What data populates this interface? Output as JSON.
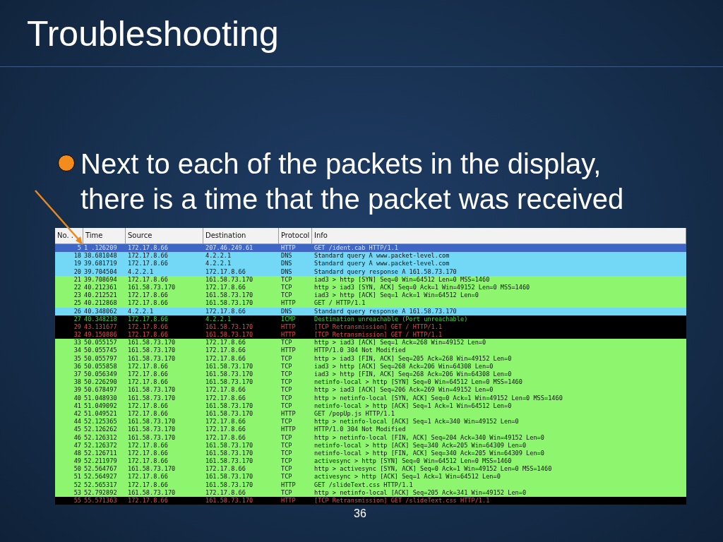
{
  "slide": {
    "title": "Troubleshooting",
    "bullet": "Next to each of the packets in the display, there is a time that the packet was received",
    "page_number": "36"
  },
  "table": {
    "columns": [
      "No. .",
      "Time",
      "Source",
      "Destination",
      "Protocol",
      "Info"
    ],
    "rows": [
      {
        "kind": "normal",
        "selected": true,
        "cells": [
          "5",
          "1 .126209",
          "172.17.8.66",
          "207.46.249.61",
          "HTTP",
          "GET /ident.cab HTTP/1.1"
        ]
      },
      {
        "kind": "dns",
        "selected": false,
        "cells": [
          "18",
          "38.681048",
          "172.17.8.66",
          "4.2.2.1",
          "DNS",
          "Standard query A www.packet-level.com"
        ]
      },
      {
        "kind": "dns",
        "selected": false,
        "cells": [
          "19",
          "39.681719",
          "172.17.8.66",
          "4.2.2.1",
          "DNS",
          "Standard query A www.packet-level.com"
        ]
      },
      {
        "kind": "dns",
        "selected": false,
        "cells": [
          "20",
          "39.704504",
          "4.2.2.1",
          "172.17.8.66",
          "DNS",
          "Standard query response A 161.58.73.170"
        ]
      },
      {
        "kind": "tcp",
        "selected": false,
        "cells": [
          "21",
          "39.708694",
          "172.17.8.66",
          "161.58.73.170",
          "TCP",
          "iad3 > http [SYN] Seq=0 Win=64512 Len=0 MSS=1460"
        ]
      },
      {
        "kind": "tcp",
        "selected": false,
        "cells": [
          "22",
          "40.212361",
          "161.58.73.170",
          "172.17.8.66",
          "TCP",
          "http > iad3 [SYN, ACK] Seq=0 Ack=1 Win=49152 Len=0 MSS=1460"
        ]
      },
      {
        "kind": "tcp",
        "selected": false,
        "cells": [
          "23",
          "40.212521",
          "172.17.8.66",
          "161.58.73.170",
          "TCP",
          "iad3 > http [ACK] Seq=1 Ack=1 Win=64512 Len=0"
        ]
      },
      {
        "kind": "tcp",
        "selected": false,
        "cells": [
          "25",
          "40.212868",
          "172.17.8.66",
          "161.58.73.170",
          "HTTP",
          "GET / HTTP/1.1"
        ]
      },
      {
        "kind": "dns",
        "selected": false,
        "cells": [
          "26",
          "40.348062",
          "4.2.2.1",
          "172.17.8.66",
          "DNS",
          "Standard query response A 161.58.73.170"
        ]
      },
      {
        "kind": "icmp",
        "selected": false,
        "cells": [
          "27",
          "40.348218",
          "172.17.8.66",
          "4.2.2.1",
          "ICMP",
          "Destination unreachable (Port unreachable)"
        ]
      },
      {
        "kind": "retrans",
        "selected": false,
        "cells": [
          "29",
          "43.131677",
          "172.17.8.66",
          "161.58.73.170",
          "HTTP",
          "[TCP Retransmission] GET / HTTP/1.1"
        ]
      },
      {
        "kind": "retrans",
        "selected": false,
        "cells": [
          "32",
          "49.150886",
          "172.17.8.66",
          "161.58.73.170",
          "HTTP",
          "[TCP Retransmission] GET / HTTP/1.1"
        ]
      },
      {
        "kind": "tcp",
        "selected": false,
        "cells": [
          "33",
          "50.055157",
          "161.58.73.170",
          "172.17.8.66",
          "TCP",
          "http > iad3 [ACK] Seq=1 Ack=268 Win=49152 Len=0"
        ]
      },
      {
        "kind": "tcp",
        "selected": false,
        "cells": [
          "34",
          "50.055745",
          "161.58.73.170",
          "172.17.8.66",
          "HTTP",
          "HTTP/1.0 304 Not Modified"
        ]
      },
      {
        "kind": "tcp",
        "selected": false,
        "cells": [
          "35",
          "50.055797",
          "161.58.73.170",
          "172.17.8.66",
          "TCP",
          "http > iad3 [FIN, ACK] Seq=205 Ack=268 Win=49152 Len=0"
        ]
      },
      {
        "kind": "tcp",
        "selected": false,
        "cells": [
          "36",
          "50.055858",
          "172.17.8.66",
          "161.58.73.170",
          "TCP",
          "iad3 > http [ACK] Seq=268 Ack=206 Win=64308 Len=0"
        ]
      },
      {
        "kind": "tcp",
        "selected": false,
        "cells": [
          "37",
          "50.056349",
          "172.17.8.66",
          "161.58.73.170",
          "TCP",
          "iad3 > http [FIN, ACK] Seq=268 Ack=206 Win=64308 Len=0"
        ]
      },
      {
        "kind": "tcp",
        "selected": false,
        "cells": [
          "38",
          "50.226290",
          "172.17.8.66",
          "161.58.73.170",
          "TCP",
          "netinfo-local > http [SYN] Seq=0 Win=64512 Len=0 MSS=1460"
        ]
      },
      {
        "kind": "tcp",
        "selected": false,
        "cells": [
          "39",
          "50.678497",
          "161.58.73.170",
          "172.17.8.66",
          "TCP",
          "http > iad3 [ACK] Seq=206 Ack=269 Win=49152 Len=0"
        ]
      },
      {
        "kind": "tcp",
        "selected": false,
        "cells": [
          "40",
          "51.048930",
          "161.58.73.170",
          "172.17.8.66",
          "TCP",
          "http > netinfo-local [SYN, ACK] Seq=0 Ack=1 Win=49152 Len=0 MSS=1460"
        ]
      },
      {
        "kind": "tcp",
        "selected": false,
        "cells": [
          "41",
          "51.049092",
          "172.17.8.66",
          "161.58.73.170",
          "TCP",
          "netinfo-local > http [ACK] Seq=1 Ack=1 Win=64512 Len=0"
        ]
      },
      {
        "kind": "tcp",
        "selected": false,
        "cells": [
          "42",
          "51.049521",
          "172.17.8.66",
          "161.58.73.170",
          "HTTP",
          "GET /popUp.js HTTP/1.1"
        ]
      },
      {
        "kind": "tcp",
        "selected": false,
        "cells": [
          "44",
          "52.125365",
          "161.58.73.170",
          "172.17.8.66",
          "TCP",
          "http > netinfo-local [ACK] Seq=1 Ack=340 Win=49152 Len=0"
        ]
      },
      {
        "kind": "tcp",
        "selected": false,
        "cells": [
          "45",
          "52.126262",
          "161.58.73.170",
          "172.17.8.66",
          "HTTP",
          "HTTP/1.0 304 Not Modified"
        ]
      },
      {
        "kind": "tcp",
        "selected": false,
        "cells": [
          "46",
          "52.126312",
          "161.58.73.170",
          "172.17.8.66",
          "TCP",
          "http > netinfo-local [FIN, ACK] Seq=204 Ack=340 Win=49152 Len=0"
        ]
      },
      {
        "kind": "tcp",
        "selected": false,
        "cells": [
          "47",
          "52.126372",
          "172.17.8.66",
          "161.58.73.170",
          "TCP",
          "netinfo-local > http [ACK] Seq=340 Ack=205 Win=64309 Len=0"
        ]
      },
      {
        "kind": "tcp",
        "selected": false,
        "cells": [
          "48",
          "52.126711",
          "172.17.8.66",
          "161.58.73.170",
          "TCP",
          "netinfo-local > http [FIN, ACK] Seq=340 Ack=205 Win=64309 Len=0"
        ]
      },
      {
        "kind": "tcp",
        "selected": false,
        "cells": [
          "49",
          "52.211979",
          "172.17.8.66",
          "161.58.73.170",
          "TCP",
          "activesync > http [SYN] Seq=0 Win=64512 Len=0 MSS=1460"
        ]
      },
      {
        "kind": "tcp",
        "selected": false,
        "cells": [
          "50",
          "52.564767",
          "161.58.73.170",
          "172.17.8.66",
          "TCP",
          "http > activesync [SYN, ACK] Seq=0 Ack=1 Win=49152 Len=0 MSS=1460"
        ]
      },
      {
        "kind": "tcp",
        "selected": false,
        "cells": [
          "51",
          "52.564927",
          "172.17.8.66",
          "161.58.73.170",
          "TCP",
          "activesync > http [ACK] Seq=1 Ack=1 Win=64512 Len=0"
        ]
      },
      {
        "kind": "tcp",
        "selected": false,
        "cells": [
          "52",
          "52.565317",
          "172.17.8.66",
          "161.58.73.170",
          "HTTP",
          "GET /slideText.css HTTP/1.1"
        ]
      },
      {
        "kind": "tcp",
        "selected": false,
        "cells": [
          "53",
          "52.792892",
          "161.58.73.170",
          "172.17.8.66",
          "TCP",
          "http > netinfo-local [ACK] Seq=205 Ack=341 Win=49152 Len=0"
        ]
      },
      {
        "kind": "retrans",
        "selected": false,
        "cells": [
          "55",
          "55.571363",
          "172.17.8.66",
          "161.58.73.170",
          "HTTP",
          "[TCP Retransmission] GET /slideText.css HTTP/1.1"
        ]
      }
    ]
  }
}
